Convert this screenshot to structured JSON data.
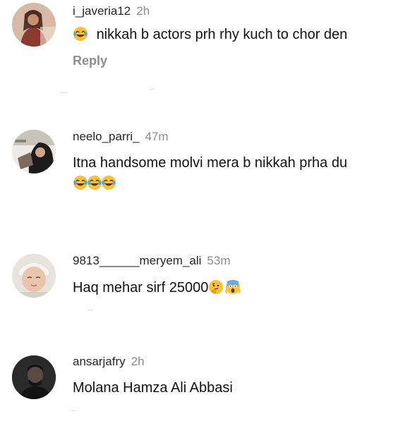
{
  "comments": [
    {
      "username": "i_javeria12",
      "time": "2h",
      "text": "nikkah b actors prh rhy kuch to chor den",
      "reply_label": "Reply",
      "leading_emoji": "face-with-tears-of-joy-icon"
    },
    {
      "username": "neelo_parri_",
      "time": "47m",
      "text": "Itna handsome molvi mera b nikkah prha du",
      "trailing_emojis": [
        "face-with-tears-of-joy-icon",
        "face-with-tears-of-joy-icon",
        "face-with-tears-of-joy-icon"
      ]
    },
    {
      "username": "9813______meryem_ali",
      "time": "53m",
      "text": "Haq mehar sirf 25000",
      "trailing_emojis": [
        "thinking-face-icon",
        "face-screaming-in-fear-icon"
      ]
    },
    {
      "username": "ansarjafry",
      "time": "2h",
      "text": "Molana Hamza Ali Abbasi"
    }
  ],
  "colors": {
    "username": "#262626",
    "time": "#8a8a8a",
    "reply": "#8e8e8e",
    "emoji_yellow": "#f7c13c",
    "emoji_tear": "#4aa8e8"
  }
}
